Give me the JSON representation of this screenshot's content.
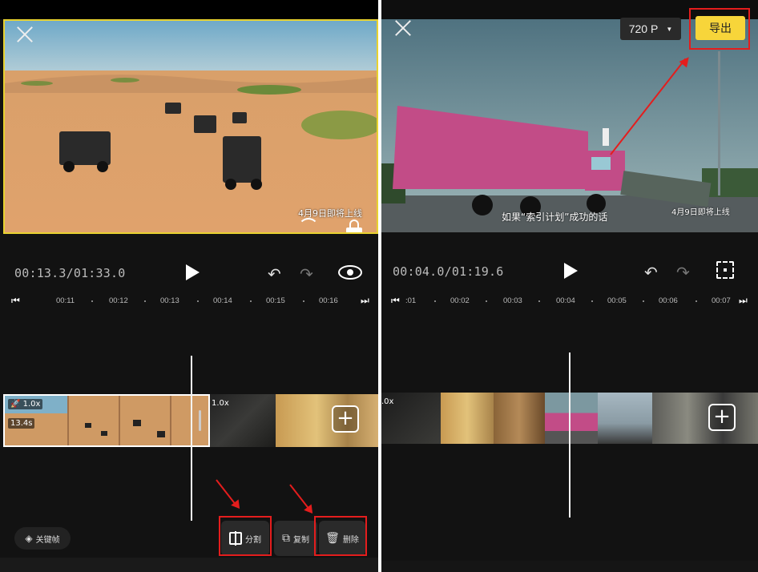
{
  "left": {
    "timecode": "00:13.3/01:33.0",
    "watermark": "4月9日即将上线",
    "ruler_ticks": [
      "00:11",
      "00:12",
      "00:13",
      "00:14",
      "00:15",
      "00:16"
    ],
    "clip_speed": "1.0x",
    "clip_duration": "13.4s",
    "next_clip_speed": "1.0x",
    "keyframe_label": "关键帧",
    "tools": {
      "split": "分割",
      "copy": "复制",
      "delete": "删除"
    }
  },
  "right": {
    "resolution": "720 P",
    "export_label": "导出",
    "timecode": "00:04.0/01:19.6",
    "subtitle": "如果“索引计划”成功的话",
    "watermark": "4月9日即将上线",
    "ruler_ticks": [
      ":01",
      "00:02",
      "00:03",
      "00:04",
      "00:05",
      "00:06",
      "00:07"
    ],
    "clip_speed": ".0x"
  },
  "colors": {
    "accent_yellow": "#f7d53a",
    "annotation_red": "#e41d1d",
    "panel_bg": "#121212"
  }
}
